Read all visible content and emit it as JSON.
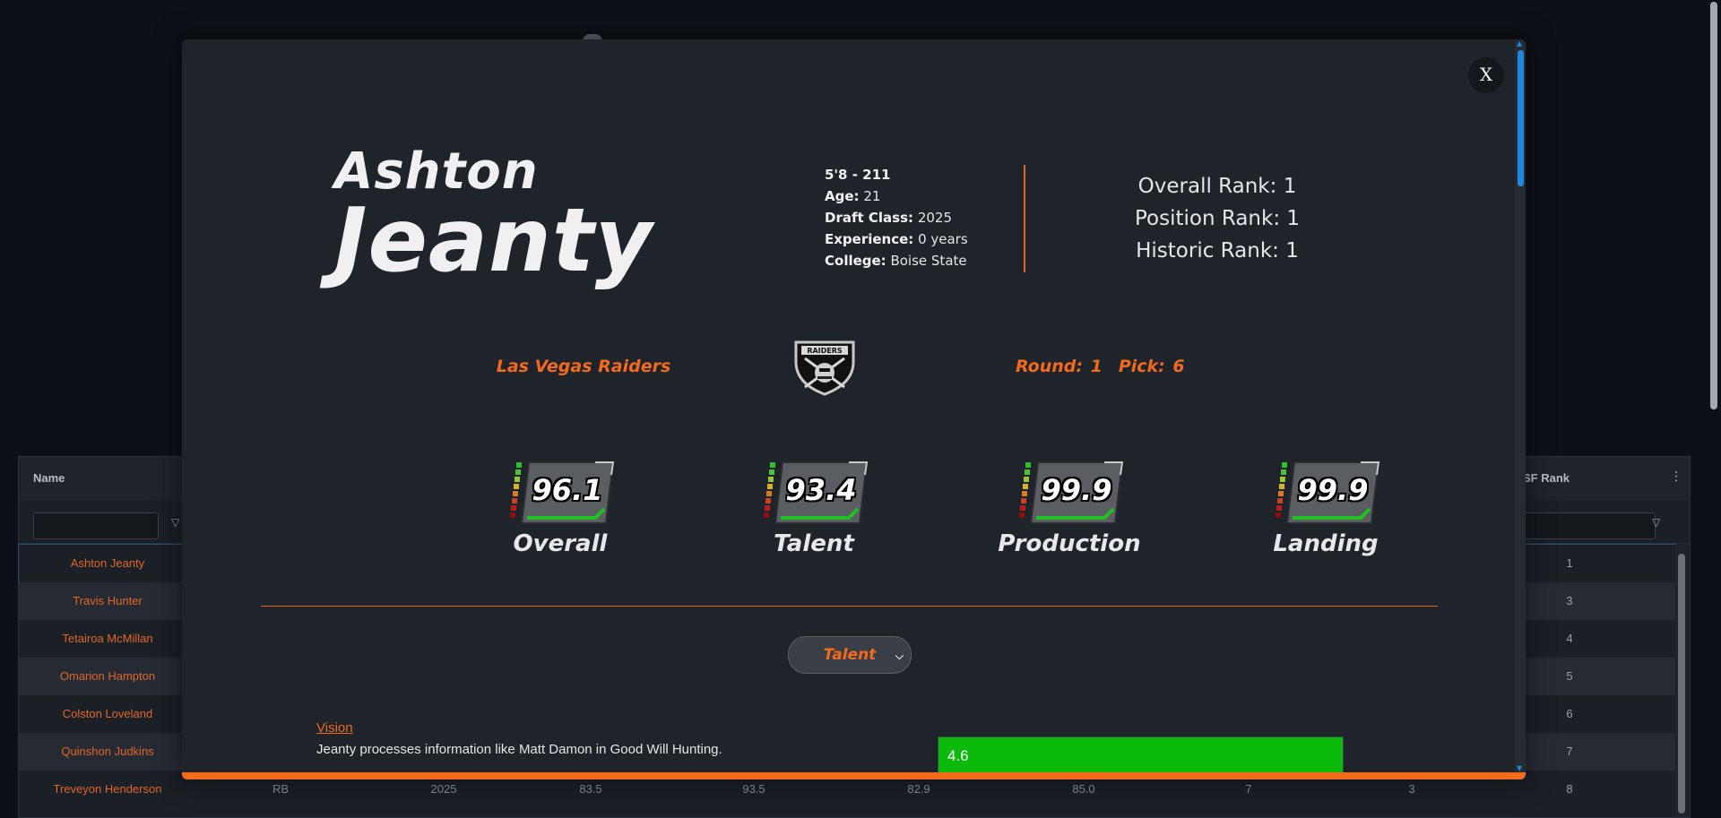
{
  "grid": {
    "header_name": "Name",
    "header_sf": "SF Rank",
    "rows": [
      {
        "name": "Ashton Jeanty",
        "sf_rank": "1"
      },
      {
        "name": "Travis Hunter",
        "sf_rank": "3"
      },
      {
        "name": "Tetairoa McMillan",
        "sf_rank": "4"
      },
      {
        "name": "Omarion Hampton",
        "sf_rank": "5"
      },
      {
        "name": "Colston Loveland",
        "sf_rank": "6"
      },
      {
        "name": "Quinshon Judkins",
        "sf_rank": "7"
      },
      {
        "name": "Treveyon Henderson",
        "pos": "RB",
        "year": "2025",
        "c1": "83.5",
        "c2": "93.5",
        "c3": "82.9",
        "c4": "85.0",
        "c5": "7",
        "c6": "3",
        "sf_rank": "8"
      }
    ]
  },
  "modal": {
    "close_label": "X",
    "first_name": "Ashton",
    "last_name": "Jeanty",
    "bio": {
      "size": "5'8 - 211",
      "age_label": "Age:",
      "age": "21",
      "draft_class_label": "Draft Class:",
      "draft_class": "2025",
      "experience_label": "Experience:",
      "experience": "0 years",
      "college_label": "College:",
      "college": "Boise State"
    },
    "ranks": {
      "overall": "Overall Rank: 1",
      "position": "Position Rank: 1",
      "historic": "Historic Rank: 1"
    },
    "team": "Las Vegas Raiders",
    "logo_text": "RAIDERS",
    "round": "Round: 1",
    "pick": "Pick: 6",
    "scores": [
      {
        "value": "96.1",
        "label": "Overall"
      },
      {
        "value": "93.4",
        "label": "Talent"
      },
      {
        "value": "99.9",
        "label": "Production"
      },
      {
        "value": "99.9",
        "label": "Landing"
      }
    ],
    "select_value": "Talent",
    "trait": {
      "title": "Vision",
      "description": "Jeanty processes information like Matt Damon in Good Will Hunting.",
      "value": "4.6",
      "fill_fraction": 1.0
    }
  },
  "colors": {
    "accent": "#f26b1d",
    "bar_green": "#0cba0c",
    "scroll_blue": "#1e87e0"
  }
}
